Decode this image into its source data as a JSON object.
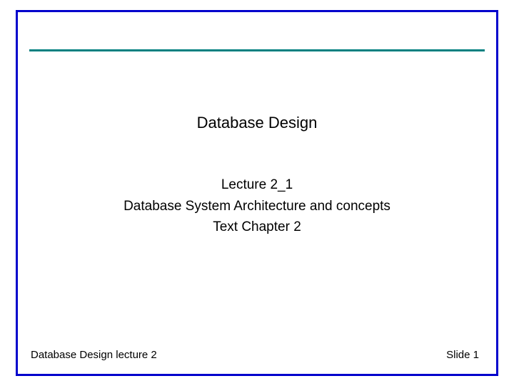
{
  "slide": {
    "title": "Database Design",
    "line1": "Lecture 2_1",
    "line2": "Database System Architecture and concepts",
    "line3": "Text Chapter 2",
    "footer_left": "Database Design lecture 2",
    "footer_right": "Slide 1"
  }
}
